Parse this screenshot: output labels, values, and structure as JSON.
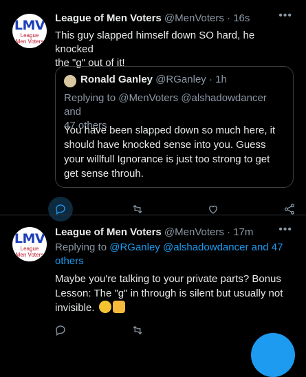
{
  "tweet1": {
    "avatar": {
      "logo": "LMV",
      "line1": "League",
      "line2": "Men Voters"
    },
    "name": "League of Men Voters",
    "handle": "@MenVoters",
    "sep": "·",
    "time": "16s",
    "more": "•••",
    "text_line1": "This guy slapped himself down SO hard, he knocked",
    "text_line2": "the \"g\" out of it!",
    "quote": {
      "name": "Ronald Ganley",
      "handle": "@RGanley",
      "sep": "·",
      "time": "1h",
      "reply_line1": "Replying to @MenVoters @alshadowdancer and",
      "reply_line2": "47 others",
      "body_line1": "You have been slapped down so much here, it",
      "body_line2": "should have knocked sense into you. Guess",
      "body_line3": "your willfull Ignorance is just too strong to get",
      "body_line4": "get sense throuh."
    }
  },
  "tweet2": {
    "avatar": {
      "logo": "LMV",
      "line1": "League",
      "line2": "Men Voters"
    },
    "name": "League of Men Voters",
    "handle": "@MenVoters",
    "sep": "·",
    "time": "17m",
    "more": "•••",
    "reply_prefix": "Replying to ",
    "reply_links_line1": "@RGanley @alshadowdancer and 47",
    "reply_links_line2": "others",
    "text_line1": "Maybe you're talking to your private parts?  Bonus",
    "text_line2": "Lesson: The \"g\" in through is silent but usually not",
    "text_line3": "invisible.",
    "emojis": [
      "rolling-on-floor-laughing-emoji",
      "thumbs-up-emoji"
    ]
  },
  "colors": {
    "accent": "#1d9bf0",
    "muted": "#8b98a5",
    "text": "#e7e9ea",
    "bg": "#000000"
  },
  "icons": [
    "reply-icon",
    "retweet-icon",
    "like-icon",
    "share-icon",
    "more-icon"
  ]
}
